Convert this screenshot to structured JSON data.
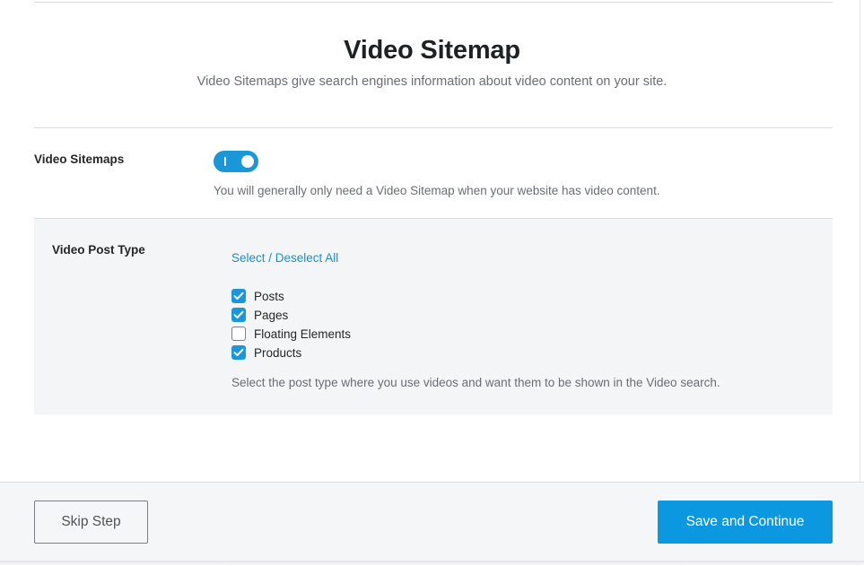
{
  "header": {
    "title": "Video Sitemap",
    "subtitle": "Video Sitemaps give search engines information about video content on your site."
  },
  "video_sitemaps": {
    "label": "Video Sitemaps",
    "toggle_on": true,
    "description": "You will generally only need a Video Sitemap when your website has video content."
  },
  "post_type": {
    "label": "Video Post Type",
    "select_all_link": "Select / Deselect All",
    "options": [
      {
        "label": "Posts",
        "checked": true
      },
      {
        "label": "Pages",
        "checked": true
      },
      {
        "label": "Floating Elements",
        "checked": false
      },
      {
        "label": "Products",
        "checked": true
      }
    ],
    "description": "Select the post type where you use videos and want them to be shown in the Video search."
  },
  "footer": {
    "skip_label": "Skip Step",
    "save_label": "Save and Continue"
  },
  "colors": {
    "accent": "#1a97d8",
    "button_primary": "#0b98e0",
    "link": "#1a8fc9"
  }
}
